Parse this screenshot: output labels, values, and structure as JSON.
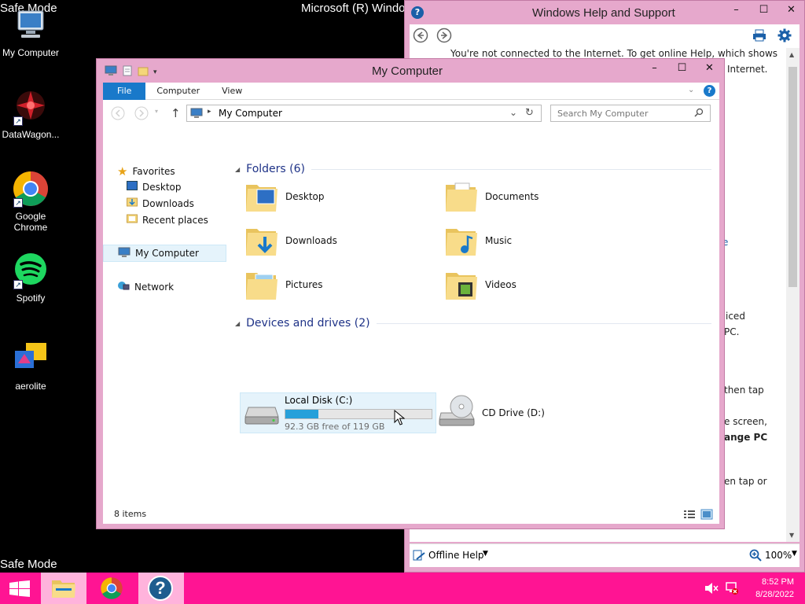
{
  "desktop": {
    "safe_mode_top": "Safe Mode",
    "safe_mode_bottom": "Safe Mode",
    "build_text": "Microsoft (R) Windo",
    "icons": [
      {
        "label": "My Computer",
        "icon": "computer-icon"
      },
      {
        "label": "DataWagon...",
        "icon": "datawagon-icon"
      },
      {
        "label": "Google Chrome",
        "icon": "chrome-icon"
      },
      {
        "label": "Spotify",
        "icon": "spotify-icon"
      },
      {
        "label": "aerolite",
        "icon": "aerolite-icon"
      }
    ]
  },
  "help_window": {
    "title": "Windows Help and Support",
    "buttons": {
      "minimize": "–",
      "maximize": "☐",
      "close": "✕"
    },
    "message_line1": "You're not connected to the Internet. To get online Help, which shows",
    "message_line2": "Internet.",
    "fragments": {
      "e": "e",
      "iced": "iced",
      "pc": "PC.",
      "then_tap": "then tap",
      "e_screen": "e screen,",
      "ange_pc": "ange PC",
      "en_tap_or": "en tap or"
    },
    "footer": {
      "offline_help": "Offline Help",
      "zoom": "100%"
    }
  },
  "explorer": {
    "title": "My Computer",
    "ribbon_tabs": [
      "File",
      "Computer",
      "View"
    ],
    "address": "My Computer",
    "search_placeholder": "Search My Computer",
    "nav": {
      "favorites": "Favorites",
      "desktop": "Desktop",
      "downloads": "Downloads",
      "recent": "Recent places",
      "my_computer": "My Computer",
      "network": "Network"
    },
    "folders_header": "Folders (6)",
    "folders": [
      "Desktop",
      "Documents",
      "Downloads",
      "Music",
      "Pictures",
      "Videos"
    ],
    "devices_header": "Devices and drives (2)",
    "drive_c": {
      "name": "Local Disk (C:)",
      "free": "92.3 GB free of 119 GB",
      "used_fraction": 0.224
    },
    "drive_d": {
      "name": "CD Drive (D:)"
    },
    "status": "8 items"
  },
  "taskbar": {
    "time": "8:52 PM",
    "date": "8/28/2022"
  },
  "colors": {
    "taskbar": "#ff1493",
    "window_frame": "#e6a8cc",
    "accent_blue": "#1979ca"
  }
}
